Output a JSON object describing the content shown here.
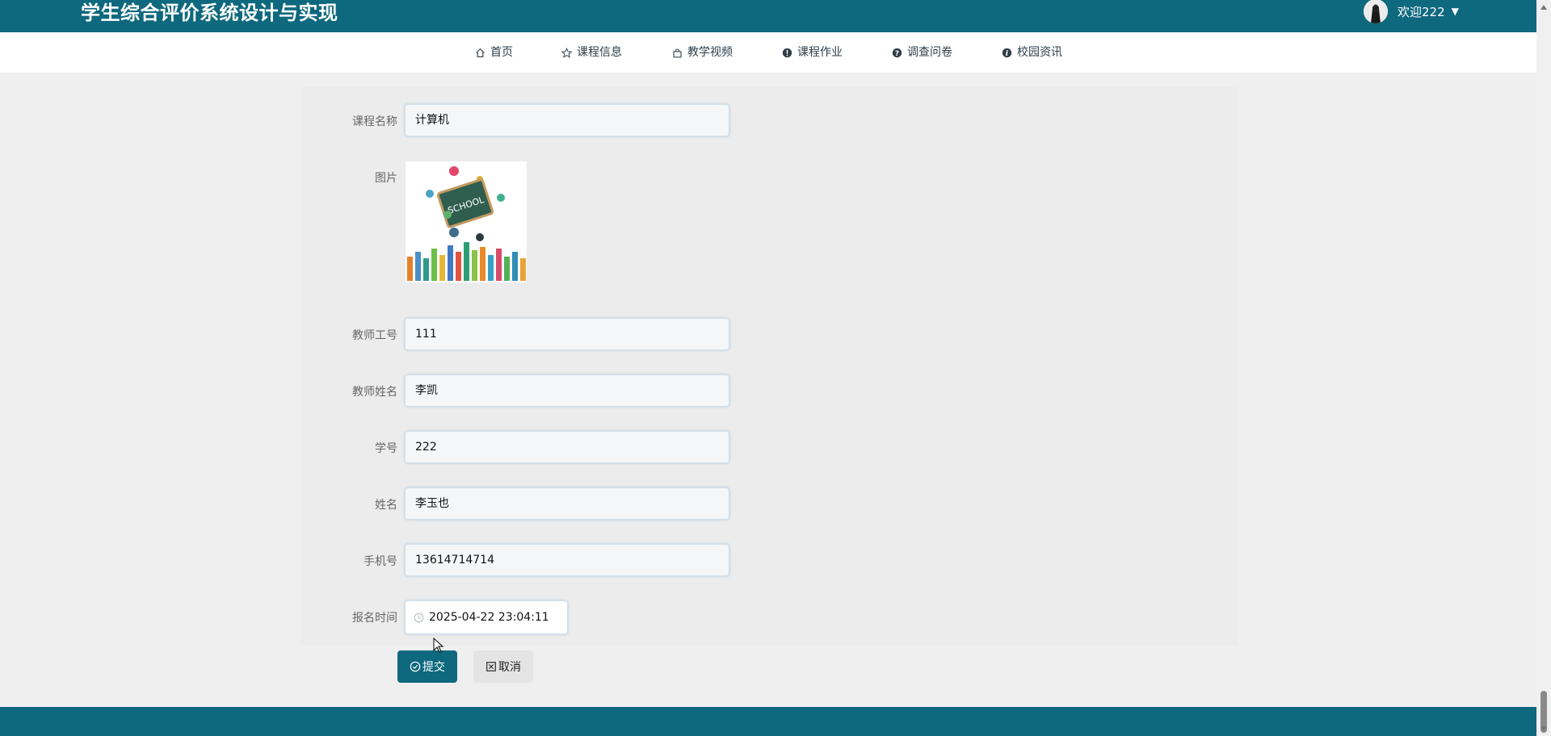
{
  "header": {
    "title": "学生综合评价系统设计与实现",
    "welcome": "欢迎222"
  },
  "nav": [
    {
      "label": "首页",
      "icon": "home-icon"
    },
    {
      "label": "课程信息",
      "icon": "star-icon"
    },
    {
      "label": "教学视频",
      "icon": "bag-icon"
    },
    {
      "label": "课程作业",
      "icon": "exclamation-icon"
    },
    {
      "label": "调查问卷",
      "icon": "question-icon"
    },
    {
      "label": "校园资讯",
      "icon": "info-icon"
    }
  ],
  "form": {
    "course_name": {
      "label": "课程名称",
      "value": "计算机"
    },
    "image": {
      "label": "图片"
    },
    "teacher_id": {
      "label": "教师工号",
      "value": "111"
    },
    "teacher_name": {
      "label": "教师姓名",
      "value": "李凯"
    },
    "student_id": {
      "label": "学号",
      "value": "222"
    },
    "student_name": {
      "label": "姓名",
      "value": "李玉也"
    },
    "phone": {
      "label": "手机号",
      "value": "13614714714"
    },
    "signup_time": {
      "label": "报名时间",
      "value": "2025-04-22 23:04:11"
    }
  },
  "buttons": {
    "submit": "提交",
    "cancel": "取消"
  },
  "colors": {
    "primary": "#0e687e",
    "background": "#efefef"
  }
}
